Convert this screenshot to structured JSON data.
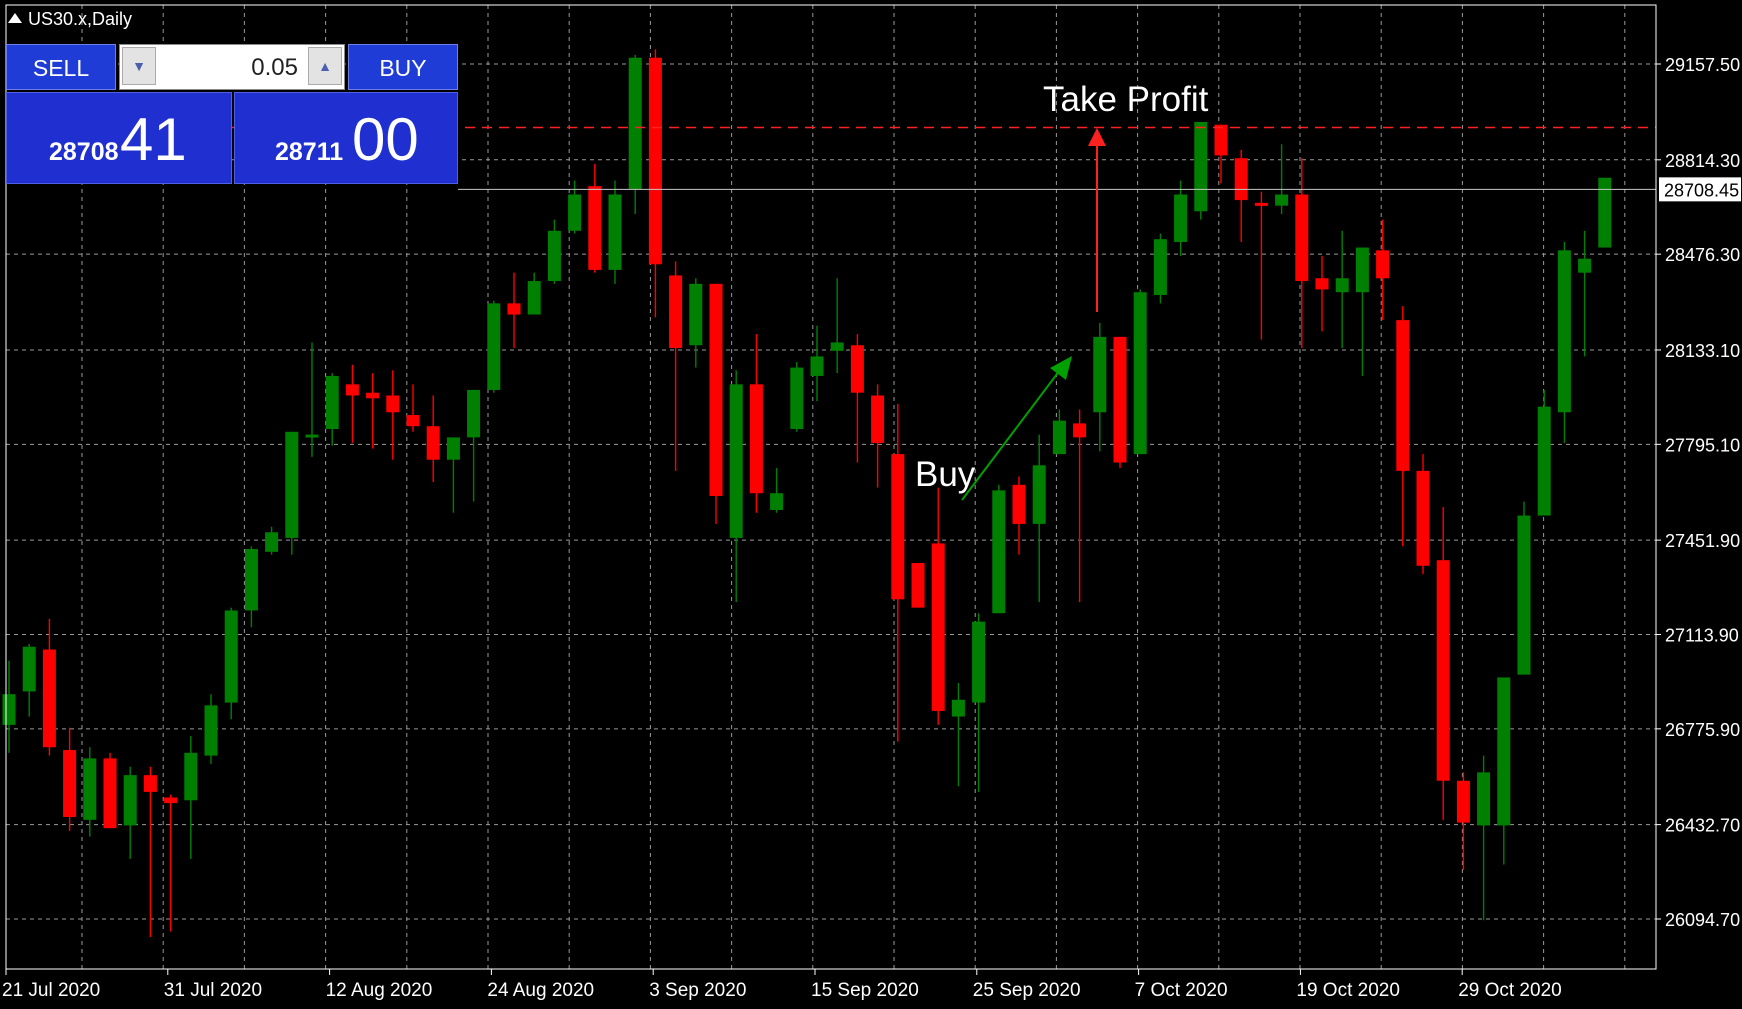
{
  "window": {
    "symbol_title": "US30.x,Daily"
  },
  "trade_panel": {
    "sell_label": "SELL",
    "buy_label": "BUY",
    "lot_value": "0.05",
    "sell_price_small": "28708",
    "sell_price_big": "41",
    "buy_price_small": "28711",
    "buy_price_big": "00",
    "stepper_down_icon": "triangle-down-icon",
    "stepper_up_icon": "triangle-up-icon"
  },
  "colors": {
    "bull": "#008000",
    "bear": "#ff0000",
    "grid": "#9a9a9a",
    "panel": "#1f2fd0",
    "background": "#000000"
  },
  "chart_data": {
    "type": "candlestick",
    "price_axis_ticks": [
      "29157.50",
      "28814.30",
      "28476.30",
      "28133.10",
      "27795.10",
      "27451.90",
      "27113.90",
      "26775.90",
      "26432.70",
      "26094.70"
    ],
    "time_axis_labels": [
      "21 Jul 2020",
      "31 Jul 2020",
      "12 Aug 2020",
      "24 Aug 2020",
      "3 Sep 2020",
      "15 Sep 2020",
      "25 Sep 2020",
      "7 Oct 2020",
      "19 Oct 2020",
      "29 Oct 2020"
    ],
    "current_price": "28708.45",
    "take_profit_level": 28930,
    "annotations": {
      "buy": "Buy",
      "take_profit": "Take Profit"
    },
    "candles": [
      [
        26790,
        27020,
        26690,
        26900
      ],
      [
        26910,
        27080,
        26820,
        27070
      ],
      [
        27060,
        27170,
        26680,
        26710
      ],
      [
        26700,
        26780,
        26410,
        26460
      ],
      [
        26450,
        26710,
        26390,
        26670
      ],
      [
        26670,
        26690,
        26420,
        26420
      ],
      [
        26430,
        26640,
        26310,
        26610
      ],
      [
        26610,
        26640,
        26030,
        26550
      ],
      [
        26530,
        26540,
        26050,
        26510
      ],
      [
        26520,
        26750,
        26310,
        26690
      ],
      [
        26680,
        26900,
        26650,
        26860
      ],
      [
        26870,
        27210,
        26810,
        27200
      ],
      [
        27200,
        27430,
        27140,
        27420
      ],
      [
        27410,
        27500,
        27400,
        27480
      ],
      [
        27460,
        27840,
        27400,
        27840
      ],
      [
        27830,
        28160,
        27750,
        27830
      ],
      [
        27850,
        28050,
        27790,
        28040
      ],
      [
        28010,
        28080,
        27800,
        27970
      ],
      [
        27980,
        28050,
        27780,
        27960
      ],
      [
        27970,
        28060,
        27740,
        27910
      ],
      [
        27900,
        28010,
        27840,
        27860
      ],
      [
        27860,
        27970,
        27660,
        27740
      ],
      [
        27740,
        27820,
        27550,
        27820
      ],
      [
        27820,
        27990,
        27590,
        27990
      ],
      [
        27990,
        28310,
        27980,
        28300
      ],
      [
        28300,
        28410,
        28140,
        28260
      ],
      [
        28260,
        28410,
        28260,
        28380
      ],
      [
        28380,
        28600,
        28370,
        28560
      ],
      [
        28560,
        28740,
        28550,
        28690
      ],
      [
        28720,
        28800,
        28410,
        28420
      ],
      [
        28420,
        28740,
        28370,
        28690
      ],
      [
        28710,
        29190,
        28620,
        29180
      ],
      [
        29180,
        29210,
        28250,
        28440
      ],
      [
        28400,
        28450,
        27700,
        28140
      ],
      [
        28150,
        28390,
        28070,
        28370
      ],
      [
        28370,
        28370,
        27510,
        27610
      ],
      [
        27460,
        28060,
        27230,
        28010
      ],
      [
        28010,
        28190,
        27550,
        27620
      ],
      [
        27560,
        27710,
        27550,
        27620
      ],
      [
        27850,
        28090,
        27840,
        28070
      ],
      [
        28040,
        28220,
        27950,
        28110
      ],
      [
        28130,
        28390,
        28050,
        28160
      ],
      [
        28150,
        28190,
        27730,
        27980
      ],
      [
        27970,
        28010,
        27640,
        27800
      ],
      [
        27760,
        27940,
        26730,
        27240
      ],
      [
        27370,
        27340,
        27210,
        27210
      ],
      [
        27440,
        27640,
        26790,
        26840
      ],
      [
        26820,
        26940,
        26570,
        26880
      ],
      [
        26870,
        27190,
        26550,
        27160
      ],
      [
        27190,
        27650,
        27220,
        27630
      ],
      [
        27650,
        27680,
        27400,
        27510
      ],
      [
        27510,
        27830,
        27230,
        27720
      ],
      [
        27760,
        27920,
        27790,
        27880
      ],
      [
        27870,
        27920,
        27230,
        27820
      ],
      [
        27910,
        28230,
        27770,
        28180
      ],
      [
        28180,
        28130,
        27710,
        27730
      ],
      [
        27760,
        28350,
        27770,
        28340
      ],
      [
        28330,
        28550,
        28300,
        28530
      ],
      [
        28520,
        28740,
        28470,
        28690
      ],
      [
        28630,
        28940,
        28600,
        28950
      ],
      [
        28940,
        28940,
        28730,
        28830
      ],
      [
        28820,
        28850,
        28520,
        28670
      ],
      [
        28660,
        28700,
        28170,
        28650
      ],
      [
        28650,
        28870,
        28620,
        28690
      ],
      [
        28690,
        28820,
        28140,
        28380
      ],
      [
        28390,
        28470,
        28200,
        28350
      ],
      [
        28340,
        28560,
        28140,
        28390
      ],
      [
        28340,
        28470,
        28040,
        28500
      ],
      [
        28490,
        28600,
        28240,
        28390
      ],
      [
        28240,
        28290,
        27430,
        27700
      ],
      [
        27700,
        27760,
        27330,
        27360
      ],
      [
        27380,
        27570,
        26450,
        26590
      ],
      [
        26590,
        26620,
        26270,
        26440
      ],
      [
        26430,
        26680,
        26090,
        26620
      ],
      [
        26430,
        26880,
        26290,
        26960
      ],
      [
        26970,
        27590,
        26980,
        27540
      ],
      [
        27540,
        27990,
        27550,
        27930
      ],
      [
        27910,
        28520,
        27800,
        28490
      ],
      [
        28410,
        28560,
        28110,
        28460
      ],
      [
        28500,
        28730,
        28520,
        28750
      ]
    ]
  }
}
